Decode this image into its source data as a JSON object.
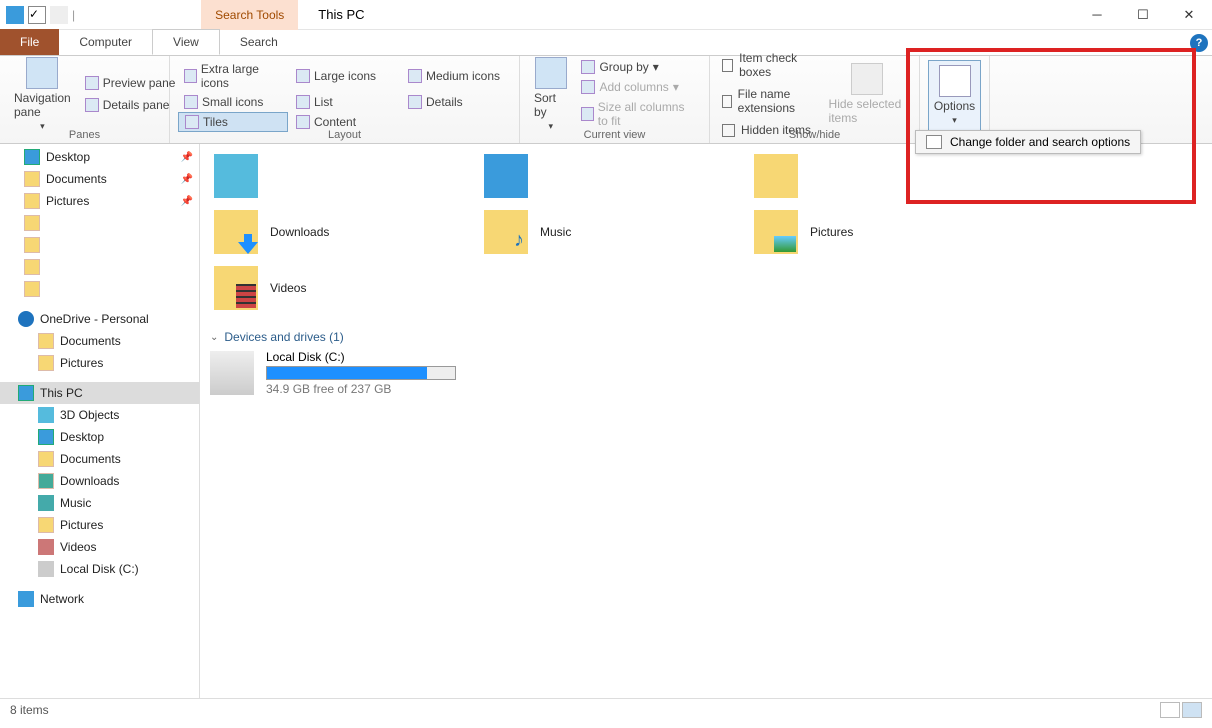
{
  "title": "This PC",
  "context_tab": "Search Tools",
  "tabs": {
    "file": "File",
    "computer": "Computer",
    "view": "View",
    "search": "Search"
  },
  "ribbon": {
    "panes": {
      "label": "Panes",
      "nav": "Navigation pane",
      "preview": "Preview pane",
      "details": "Details pane"
    },
    "layout": {
      "label": "Layout",
      "xl": "Extra large icons",
      "l": "Large icons",
      "m": "Medium icons",
      "s": "Small icons",
      "list": "List",
      "det": "Details",
      "tiles": "Tiles",
      "content": "Content"
    },
    "currentview": {
      "label": "Current view",
      "sort": "Sort by",
      "group": "Group by",
      "addcol": "Add columns",
      "size": "Size all columns to fit"
    },
    "showhide": {
      "label": "Show/hide",
      "item": "Item check boxes",
      "ext": "File name extensions",
      "hidden": "Hidden items",
      "hide": "Hide selected items"
    },
    "options": {
      "btn": "Options",
      "menu": "Change folder and search options"
    }
  },
  "sidebar": {
    "desktop": "Desktop",
    "documents": "Documents",
    "pictures": "Pictures",
    "onedrive": "OneDrive - Personal",
    "od_docs": "Documents",
    "od_pics": "Pictures",
    "thispc": "This PC",
    "obj3d": "3D Objects",
    "desk2": "Desktop",
    "docs2": "Documents",
    "dl": "Downloads",
    "music": "Music",
    "pics2": "Pictures",
    "vids": "Videos",
    "disk": "Local Disk (C:)",
    "network": "Network"
  },
  "folders": {
    "downloads": "Downloads",
    "music": "Music",
    "pictures": "Pictures",
    "videos": "Videos"
  },
  "section": "Devices and drives (1)",
  "drive": {
    "name": "Local Disk (C:)",
    "free": "34.9 GB free of 237 GB",
    "pct": 85
  },
  "status": "8 items"
}
